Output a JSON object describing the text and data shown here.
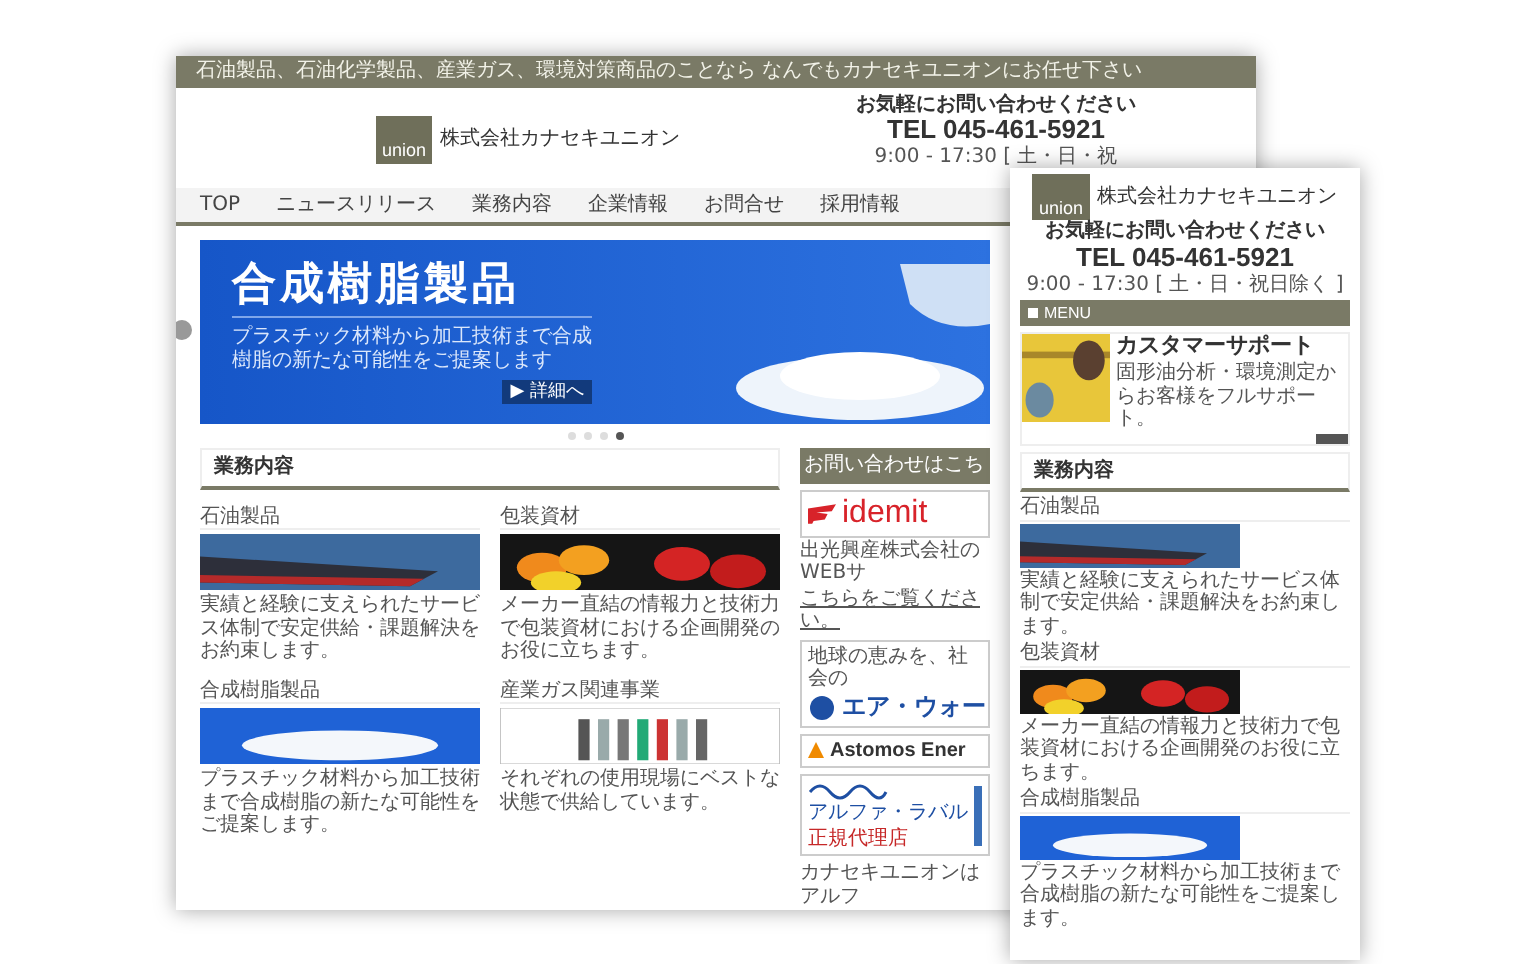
{
  "desktop": {
    "top_bar": "石油製品、石油化学製品、産業ガス、環境対策商品のことなら なんでもカナセキユニオンにお任せ下さい",
    "logo": "union",
    "company": "株式会社カナセキユニオン",
    "contact": {
      "lead": "お気軽にお問い合わせください",
      "tel": "TEL 045-461-5921",
      "hours": "9:00 - 17:30 [ 土・日・祝"
    },
    "nav": [
      "TOP",
      "ニュースリリース",
      "業務内容",
      "企業情報",
      "お問合せ",
      "採用情報"
    ],
    "slider": {
      "title": "合成樹脂製品",
      "lines": [
        "プラスチック材料から加工技術まで合成",
        "樹脂の新たな可能性をご提案します"
      ],
      "button": "▶ 詳細へ",
      "dots": [
        {
          "selected": false
        },
        {
          "selected": false
        },
        {
          "selected": false
        },
        {
          "selected": true
        }
      ]
    },
    "section_title": "業務内容",
    "services": [
      {
        "title": "石油製品",
        "kind": "ship",
        "text": "実績と経験に支えられたサービス体制で安定供給・課題解決をお約束します。"
      },
      {
        "title": "包装資材",
        "kind": "fruit",
        "text": "メーカー直結の情報力と技術力で包装資材における企画開発のお役に立ちます。"
      },
      {
        "title": "合成樹脂製品",
        "kind": "pellets",
        "text": "プラスチック材料から加工技術まで合成樹脂の新たな可能性をご提案します。"
      },
      {
        "title": "産業ガス関連事業",
        "kind": "cylinders",
        "text": "それぞれの使用現場にベストな状態で供給しています。"
      }
    ],
    "sidebar": {
      "title": "お問い合わせはこち",
      "banners": [
        {
          "kind": "idemitsu",
          "logo": "idemit",
          "text": "出光興産株式会社のWEBサ",
          "link": "こちらをご覧ください。"
        },
        {
          "kind": "airwater",
          "lead": "地球の恵みを、社会の",
          "logo": "エア・ウォー"
        },
        {
          "kind": "astomos",
          "logo": "Astomos Ener"
        },
        {
          "kind": "alfalaval",
          "logo": "アルファ・ラバル",
          "sub": "正規代理店"
        }
      ],
      "note": "カナセキユニオンはアルフ"
    }
  },
  "mobile": {
    "logo": "union",
    "company": "株式会社カナセキユニオン",
    "lead": "お気軽にお問い合わせください",
    "tel": "TEL 045-461-5921",
    "hours": "9:00 - 17:30 [ 土・日・祝日除く ]",
    "menu": "MENU",
    "banner": {
      "title": "カスタマーサポート",
      "text": "固形油分析・環境測定からお客様をフルサポート。"
    },
    "section_title": "業務内容",
    "services": [
      {
        "title": "石油製品",
        "kind": "ship",
        "text": "実績と経験に支えられたサービス体制で安定供給・課題解決をお約束します。"
      },
      {
        "title": "包装資材",
        "kind": "fruit",
        "text": "メーカー直結の情報力と技術力で包装資材における企画開発のお役に立ちます。"
      },
      {
        "title": "合成樹脂製品",
        "kind": "pellets",
        "text": "プラスチック材料から加工技術まで合成樹脂の新たな可能性をご提案します。"
      }
    ]
  }
}
